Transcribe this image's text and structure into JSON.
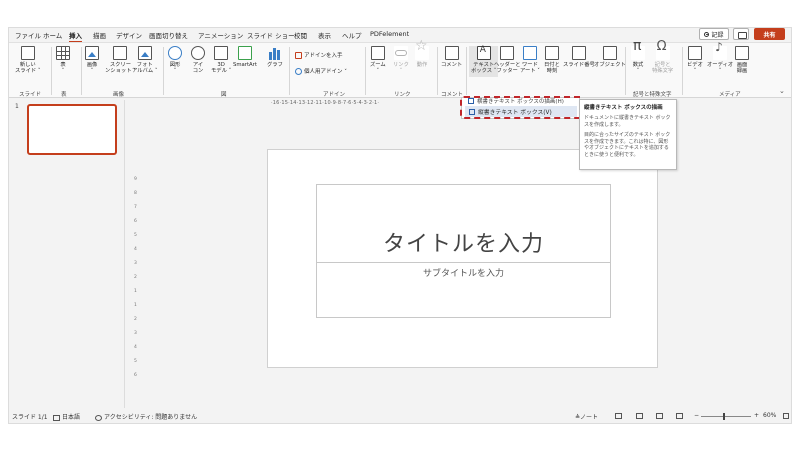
{
  "tabs": [
    {
      "label": "ファイル",
      "active": false
    },
    {
      "label": "ホーム",
      "active": false
    },
    {
      "label": "挿入",
      "active": true
    },
    {
      "label": "描画",
      "active": false
    },
    {
      "label": "デザイン",
      "active": false
    },
    {
      "label": "画面切り替え",
      "active": false
    },
    {
      "label": "アニメーション",
      "active": false
    },
    {
      "label": "スライド ショー",
      "active": false
    },
    {
      "label": "校閲",
      "active": false
    },
    {
      "label": "表示",
      "active": false
    },
    {
      "label": "ヘルプ",
      "active": false
    },
    {
      "label": "PDFelement",
      "active": false
    }
  ],
  "top_right": {
    "record": "記録",
    "share": "共有"
  },
  "ribbon": {
    "new_slide": "新しい\nスライド ˅",
    "table": "表\n˅",
    "image": "画像\n˅",
    "screenshot": "スクリー\nンショット ˅",
    "photo_album": "フォト\nアルバム ˅",
    "shapes": "図形\n˅",
    "icons": "アイ\nコン",
    "model_3d": "3D\nモデル ˅",
    "smartart": "SmartArt",
    "chart": "グラフ",
    "get_addins": "アドインを入手",
    "personal_addins": "個人用アドイン ˅",
    "zoom": "ズーム\n˅",
    "link": "リンク\n˅",
    "action": "動作",
    "comment": "コメント",
    "textbox": "テキスト\nボックス ˅",
    "header_footer": "ヘッダーと\nフッター",
    "wordart": "ワード\nアート ˅",
    "datetime": "日付と\n時刻",
    "slide_number": "スライド番号",
    "object": "オブジェクト",
    "equation": "数式\n˅",
    "symbol": "記号と\n特殊文字",
    "video": "ビデオ\n˅",
    "audio": "オーディオ\n˅",
    "screen_record": "画面\n録画",
    "groups": {
      "slides": "スライド",
      "tables": "表",
      "images": "画像",
      "illustrations": "図",
      "addins": "アドイン",
      "links": "リンク",
      "comments": "コメント",
      "symbols": "記号と特殊文字",
      "media": "メディア"
    }
  },
  "ruler": {
    "horizontal": "·16·15·14·13·12·11·10·9·8·7·6·5·4·3·2·1·"
  },
  "sidebar": {
    "slide_number": "1"
  },
  "slide": {
    "title_placeholder": "タイトルを入力",
    "subtitle_placeholder": "サブタイトルを入力"
  },
  "dropdown": {
    "item1": "横書きテキスト ボックスの描画(H)",
    "item2": "縦書きテキスト ボックス(V)"
  },
  "tooltip": {
    "title": "縦書きテキスト ボックスの描画",
    "body1": "ドキュメントに縦書きテキスト ボックスを作成します。",
    "body2": "目的に合ったサイズのテキスト ボックスを作成できます。これは特に、図形やオブジェクトにテキストを追加するときに使うと便利です。"
  },
  "statusbar": {
    "slide": "スライド 1/1",
    "language": "日本語",
    "accessibility": "アクセシビリティ: 問題ありません",
    "notes": "ノート",
    "zoom": "60%",
    "zoom_minus": "−",
    "zoom_plus": "+"
  },
  "colors": {
    "accent": "#c43e1c",
    "highlight_frame": "#c0262a",
    "menu_hover": "#dfe7f3"
  }
}
